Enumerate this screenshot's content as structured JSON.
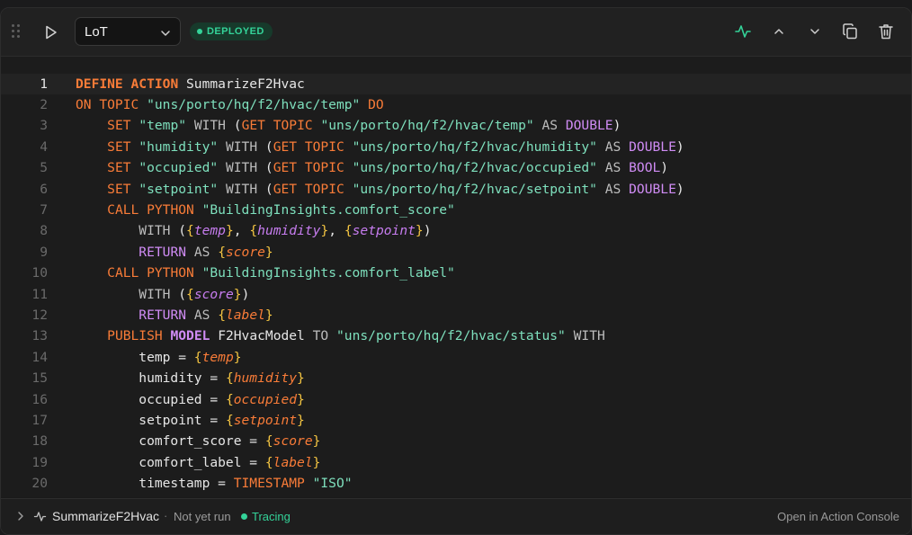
{
  "header": {
    "language_value": "LoT",
    "status_badge": "DEPLOYED"
  },
  "code_lines": [
    {
      "n": "1",
      "parts": [
        [
          "kwb",
          "DEFINE"
        ],
        [
          "t",
          " "
        ],
        [
          "kwb",
          "ACTION"
        ],
        [
          "t",
          " SummarizeF2Hvac"
        ]
      ]
    },
    {
      "n": "2",
      "parts": [
        [
          "kw",
          "ON TOPIC"
        ],
        [
          "t",
          " "
        ],
        [
          "str",
          "\"uns/porto/hq/f2/hvac/temp\""
        ],
        [
          "t",
          " "
        ],
        [
          "kw",
          "DO"
        ]
      ]
    },
    {
      "n": "3",
      "parts": [
        [
          "t",
          "    "
        ],
        [
          "kw",
          "SET"
        ],
        [
          "t",
          " "
        ],
        [
          "str",
          "\"temp\""
        ],
        [
          "t",
          " "
        ],
        [
          "gry",
          "WITH"
        ],
        [
          "t",
          " ("
        ],
        [
          "kw",
          "GET TOPIC"
        ],
        [
          "t",
          " "
        ],
        [
          "str",
          "\"uns/porto/hq/f2/hvac/temp\""
        ],
        [
          "t",
          " "
        ],
        [
          "gry",
          "AS"
        ],
        [
          "t",
          " "
        ],
        [
          "kwp",
          "DOUBLE"
        ],
        [
          "t",
          ")"
        ]
      ]
    },
    {
      "n": "4",
      "parts": [
        [
          "t",
          "    "
        ],
        [
          "kw",
          "SET"
        ],
        [
          "t",
          " "
        ],
        [
          "str",
          "\"humidity\""
        ],
        [
          "t",
          " "
        ],
        [
          "gry",
          "WITH"
        ],
        [
          "t",
          " ("
        ],
        [
          "kw",
          "GET TOPIC"
        ],
        [
          "t",
          " "
        ],
        [
          "str",
          "\"uns/porto/hq/f2/hvac/humidity\""
        ],
        [
          "t",
          " "
        ],
        [
          "gry",
          "AS"
        ],
        [
          "t",
          " "
        ],
        [
          "kwp",
          "DOUBLE"
        ],
        [
          "t",
          ")"
        ]
      ]
    },
    {
      "n": "5",
      "parts": [
        [
          "t",
          "    "
        ],
        [
          "kw",
          "SET"
        ],
        [
          "t",
          " "
        ],
        [
          "str",
          "\"occupied\""
        ],
        [
          "t",
          " "
        ],
        [
          "gry",
          "WITH"
        ],
        [
          "t",
          " ("
        ],
        [
          "kw",
          "GET TOPIC"
        ],
        [
          "t",
          " "
        ],
        [
          "str",
          "\"uns/porto/hq/f2/hvac/occupied\""
        ],
        [
          "t",
          " "
        ],
        [
          "gry",
          "AS"
        ],
        [
          "t",
          " "
        ],
        [
          "kwp",
          "BOOL"
        ],
        [
          "t",
          ")"
        ]
      ]
    },
    {
      "n": "6",
      "parts": [
        [
          "t",
          "    "
        ],
        [
          "kw",
          "SET"
        ],
        [
          "t",
          " "
        ],
        [
          "str",
          "\"setpoint\""
        ],
        [
          "t",
          " "
        ],
        [
          "gry",
          "WITH"
        ],
        [
          "t",
          " ("
        ],
        [
          "kw",
          "GET TOPIC"
        ],
        [
          "t",
          " "
        ],
        [
          "str",
          "\"uns/porto/hq/f2/hvac/setpoint\""
        ],
        [
          "t",
          " "
        ],
        [
          "gry",
          "AS"
        ],
        [
          "t",
          " "
        ],
        [
          "kwp",
          "DOUBLE"
        ],
        [
          "t",
          ")"
        ]
      ]
    },
    {
      "n": "7",
      "parts": [
        [
          "t",
          "    "
        ],
        [
          "kw",
          "CALL PYTHON"
        ],
        [
          "t",
          " "
        ],
        [
          "str",
          "\"BuildingInsights.comfort_score\""
        ]
      ]
    },
    {
      "n": "8",
      "parts": [
        [
          "t",
          "        "
        ],
        [
          "gry",
          "WITH"
        ],
        [
          "t",
          " ("
        ],
        [
          "br",
          "{"
        ],
        [
          "vp",
          "temp"
        ],
        [
          "br",
          "}"
        ],
        [
          "t",
          ", "
        ],
        [
          "br",
          "{"
        ],
        [
          "vp",
          "humidity"
        ],
        [
          "br",
          "}"
        ],
        [
          "t",
          ", "
        ],
        [
          "br",
          "{"
        ],
        [
          "vp",
          "setpoint"
        ],
        [
          "br",
          "}"
        ],
        [
          "t",
          ")"
        ]
      ]
    },
    {
      "n": "9",
      "parts": [
        [
          "t",
          "        "
        ],
        [
          "kwp",
          "RETURN"
        ],
        [
          "t",
          " "
        ],
        [
          "gry",
          "AS"
        ],
        [
          "t",
          " "
        ],
        [
          "br",
          "{"
        ],
        [
          "vo",
          "score"
        ],
        [
          "br",
          "}"
        ]
      ]
    },
    {
      "n": "10",
      "parts": [
        [
          "t",
          "    "
        ],
        [
          "kw",
          "CALL PYTHON"
        ],
        [
          "t",
          " "
        ],
        [
          "str",
          "\"BuildingInsights.comfort_label\""
        ]
      ]
    },
    {
      "n": "11",
      "parts": [
        [
          "t",
          "        "
        ],
        [
          "gry",
          "WITH"
        ],
        [
          "t",
          " ("
        ],
        [
          "br",
          "{"
        ],
        [
          "vp",
          "score"
        ],
        [
          "br",
          "}"
        ],
        [
          "t",
          ")"
        ]
      ]
    },
    {
      "n": "12",
      "parts": [
        [
          "t",
          "        "
        ],
        [
          "kwp",
          "RETURN"
        ],
        [
          "t",
          " "
        ],
        [
          "gry",
          "AS"
        ],
        [
          "t",
          " "
        ],
        [
          "br",
          "{"
        ],
        [
          "vo",
          "label"
        ],
        [
          "br",
          "}"
        ]
      ]
    },
    {
      "n": "13",
      "parts": [
        [
          "t",
          "    "
        ],
        [
          "kw",
          "PUBLISH"
        ],
        [
          "t",
          " "
        ],
        [
          "kwpb",
          "MODEL"
        ],
        [
          "t",
          " F2HvacModel "
        ],
        [
          "gry",
          "TO"
        ],
        [
          "t",
          " "
        ],
        [
          "str",
          "\"uns/porto/hq/f2/hvac/status\""
        ],
        [
          "t",
          " "
        ],
        [
          "gry",
          "WITH"
        ]
      ]
    },
    {
      "n": "14",
      "parts": [
        [
          "t",
          "        temp = "
        ],
        [
          "br",
          "{"
        ],
        [
          "vo",
          "temp"
        ],
        [
          "br",
          "}"
        ]
      ]
    },
    {
      "n": "15",
      "parts": [
        [
          "t",
          "        humidity = "
        ],
        [
          "br",
          "{"
        ],
        [
          "vo",
          "humidity"
        ],
        [
          "br",
          "}"
        ]
      ]
    },
    {
      "n": "16",
      "parts": [
        [
          "t",
          "        occupied = "
        ],
        [
          "br",
          "{"
        ],
        [
          "vo",
          "occupied"
        ],
        [
          "br",
          "}"
        ]
      ]
    },
    {
      "n": "17",
      "parts": [
        [
          "t",
          "        setpoint = "
        ],
        [
          "br",
          "{"
        ],
        [
          "vo",
          "setpoint"
        ],
        [
          "br",
          "}"
        ]
      ]
    },
    {
      "n": "18",
      "parts": [
        [
          "t",
          "        comfort_score = "
        ],
        [
          "br",
          "{"
        ],
        [
          "vo",
          "score"
        ],
        [
          "br",
          "}"
        ]
      ]
    },
    {
      "n": "19",
      "parts": [
        [
          "t",
          "        comfort_label = "
        ],
        [
          "br",
          "{"
        ],
        [
          "vo",
          "label"
        ],
        [
          "br",
          "}"
        ]
      ]
    },
    {
      "n": "20",
      "parts": [
        [
          "t",
          "        timestamp = "
        ],
        [
          "kw",
          "TIMESTAMP"
        ],
        [
          "t",
          " "
        ],
        [
          "str",
          "\"ISO\""
        ]
      ]
    }
  ],
  "footer": {
    "action_name": "SummarizeF2Hvac",
    "separator": "·",
    "run_status": "Not yet run",
    "tracing_label": "Tracing",
    "open_link": "Open in Action Console"
  },
  "colors": {
    "keyword": "#f97c38",
    "type": "#d08cf5",
    "string": "#7ee0bd",
    "brace": "#f4c542",
    "accent": "#34d399"
  },
  "icons": [
    "drag-handle-icon",
    "play-icon",
    "chevron-down-icon",
    "activity-icon",
    "chevron-up-icon",
    "copy-icon",
    "trash-icon",
    "chevron-right-icon"
  ]
}
